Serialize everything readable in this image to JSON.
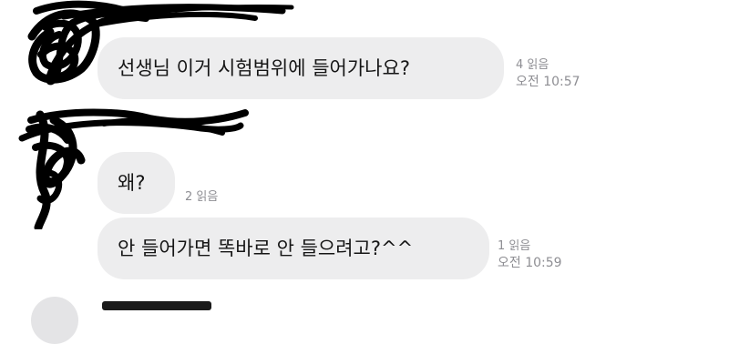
{
  "messages": [
    {
      "text": "선생님 이거 시험범위에 들어가나요?",
      "read": "4 읽음",
      "time": "오전 10:57"
    },
    {
      "text": "왜?",
      "read": "2 읽음",
      "time": ""
    },
    {
      "text": "안 들어가면 똑바로 안 들으려고?^^",
      "read": "1 읽음",
      "time": "오전 10:59"
    }
  ],
  "icons": {
    "redaction_1": "scribble-redaction-icon",
    "redaction_2": "scribble-redaction-icon"
  },
  "colors": {
    "bubble": "#ededee",
    "meta_text": "#8e8e93",
    "redaction": "#000000"
  }
}
